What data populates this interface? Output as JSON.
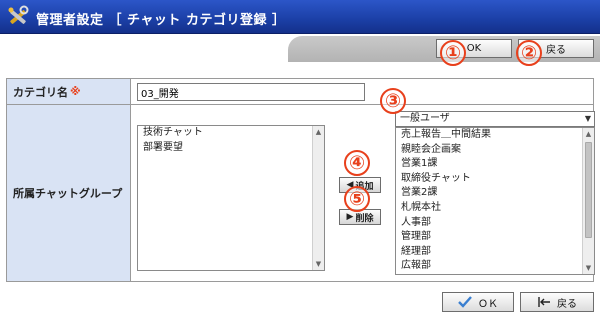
{
  "header": {
    "title": "管理者設定 ［ チャット カテゴリ登録 ］",
    "icon": "tools-icon"
  },
  "top_buttons": {
    "ok": "OK",
    "back": "戻る"
  },
  "bottom_buttons": {
    "ok": "ＯＫ",
    "back": "戻る"
  },
  "form": {
    "category_label": "カテゴリ名",
    "required_mark": "※",
    "category_value": "03_開発",
    "group_label": "所属チャットグループ"
  },
  "selected_groups": [
    "技術チャット",
    "部署要望"
  ],
  "group_filter": {
    "selected": "一般ユーザ"
  },
  "available_groups": [
    "売上報告＿中間結果",
    "親睦会企画案",
    "営業1課",
    "取締役チャット",
    "営業2課",
    "札幌本社",
    "人事部",
    "管理部",
    "経理部",
    "広報部"
  ],
  "move_buttons": {
    "add": "追加",
    "remove": "削除"
  },
  "markers": [
    "①",
    "②",
    "③",
    "④",
    "⑤"
  ],
  "colors": {
    "header_bg": "#1b3fa6",
    "label_bg": "#d9e3f4",
    "marker": "#e8401c"
  }
}
